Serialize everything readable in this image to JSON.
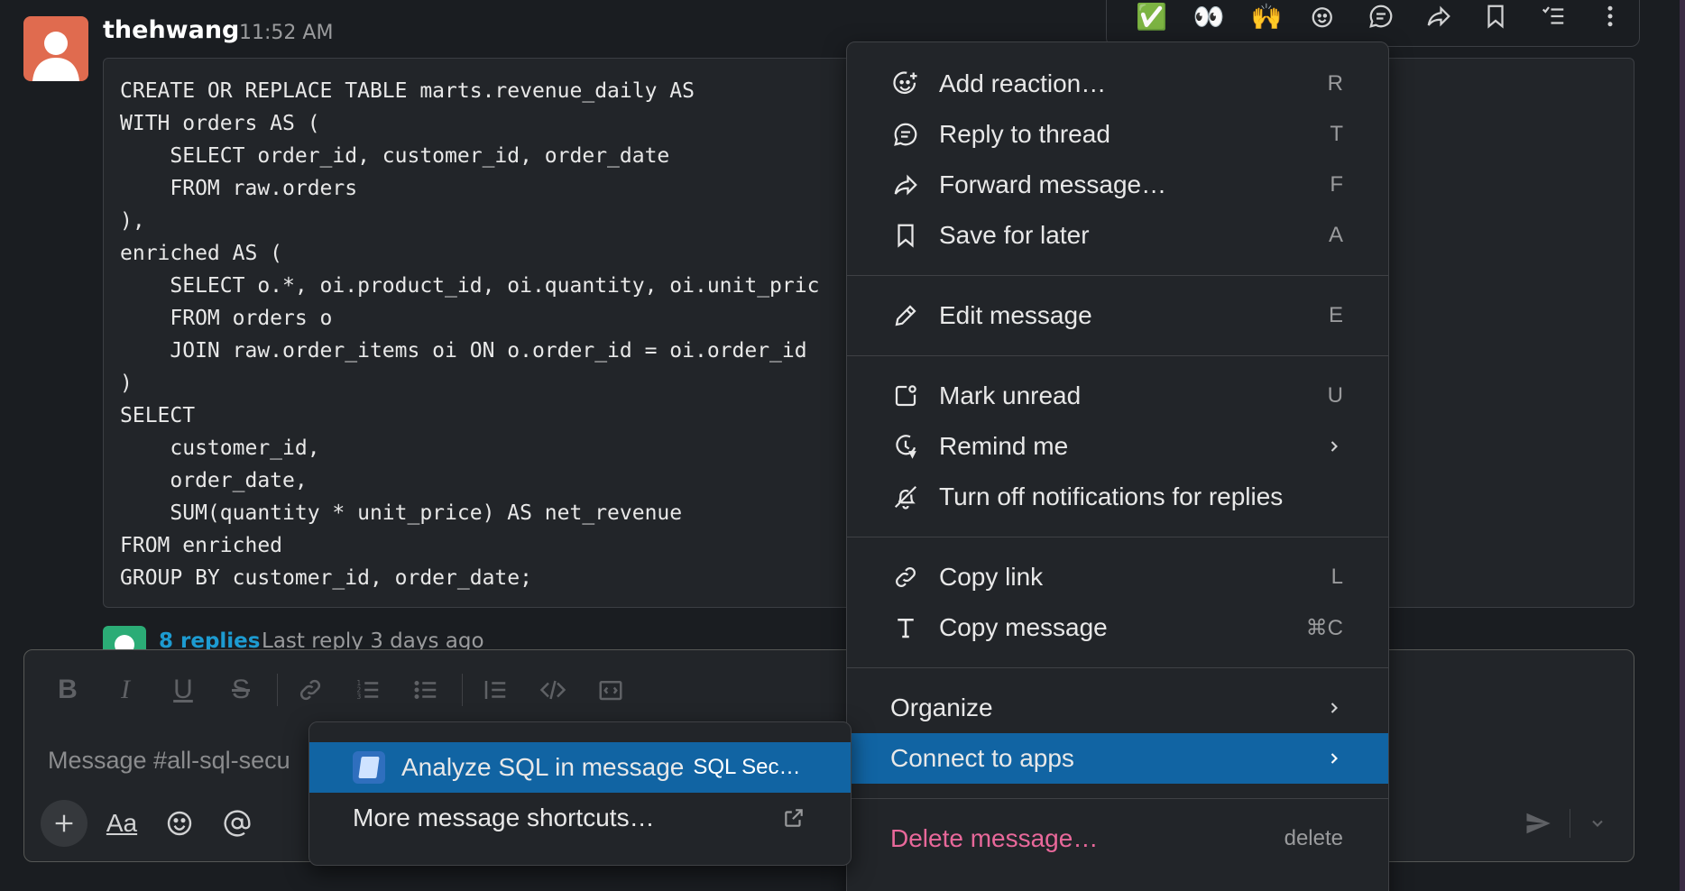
{
  "message": {
    "author": "thehwang",
    "time": "11:52 AM",
    "code_lines": [
      "CREATE OR REPLACE TABLE marts.revenue_daily AS",
      "WITH orders AS (",
      "    SELECT order_id, customer_id, order_date",
      "    FROM raw.orders",
      "),",
      "enriched AS (",
      "    SELECT o.*, oi.product_id, oi.quantity, oi.unit_pric",
      "    FROM orders o",
      "    JOIN raw.order_items oi ON o.order_id = oi.order_id",
      ")",
      "SELECT",
      "    customer_id,",
      "    order_date,",
      "    SUM(quantity * unit_price) AS net_revenue",
      "FROM enriched",
      "GROUP BY customer_id, order_date;"
    ],
    "replies_link": "8 replies",
    "replies_meta": "Last reply 3 days ago"
  },
  "hover_toolbar": {
    "icons": [
      "check-emoji-icon",
      "eyes-emoji-icon",
      "raised-hands-emoji-icon",
      "add-reaction-icon",
      "reply-thread-icon",
      "forward-icon",
      "bookmark-icon",
      "more-actions-list-icon",
      "more-vertical-icon"
    ],
    "emoji": [
      "✅",
      "👀",
      "🙌"
    ]
  },
  "context_menu": {
    "items": [
      {
        "label": "Add reaction…",
        "key": "R",
        "icon": "add-reaction-icon"
      },
      {
        "label": "Reply to thread",
        "key": "T",
        "icon": "reply-thread-icon"
      },
      {
        "label": "Forward message…",
        "key": "F",
        "icon": "forward-icon"
      },
      {
        "label": "Save for later",
        "key": "A",
        "icon": "bookmark-icon"
      },
      {
        "label": "Edit message",
        "key": "E",
        "icon": "pencil-icon"
      },
      {
        "label": "Mark unread",
        "key": "U",
        "icon": "mark-unread-icon"
      },
      {
        "label": "Remind me",
        "key": "",
        "icon": "clock-icon"
      },
      {
        "label": "Turn off notifications for replies",
        "key": "",
        "icon": "bell-off-icon"
      },
      {
        "label": "Copy link",
        "key": "L",
        "icon": "link-icon"
      },
      {
        "label": "Copy message",
        "key": "⌘C",
        "icon": "text-t-icon"
      },
      {
        "label": "Organize",
        "key": ""
      },
      {
        "label": "Connect to apps",
        "key": ""
      },
      {
        "label": "Delete message…",
        "key": "delete"
      }
    ]
  },
  "sub_menu": {
    "analyze_label": "Analyze SQL in message",
    "analyze_tag": "SQL Sec…",
    "more_label": "More message shortcuts…"
  },
  "composer": {
    "placeholder": "Message #all-sql-secu"
  },
  "colors": {
    "background": "#1a1d21",
    "menu_bg": "#222529",
    "active": "#1164a3",
    "danger": "#e8689a",
    "link": "#1d9bd1",
    "avatar": "#e06b4f"
  }
}
